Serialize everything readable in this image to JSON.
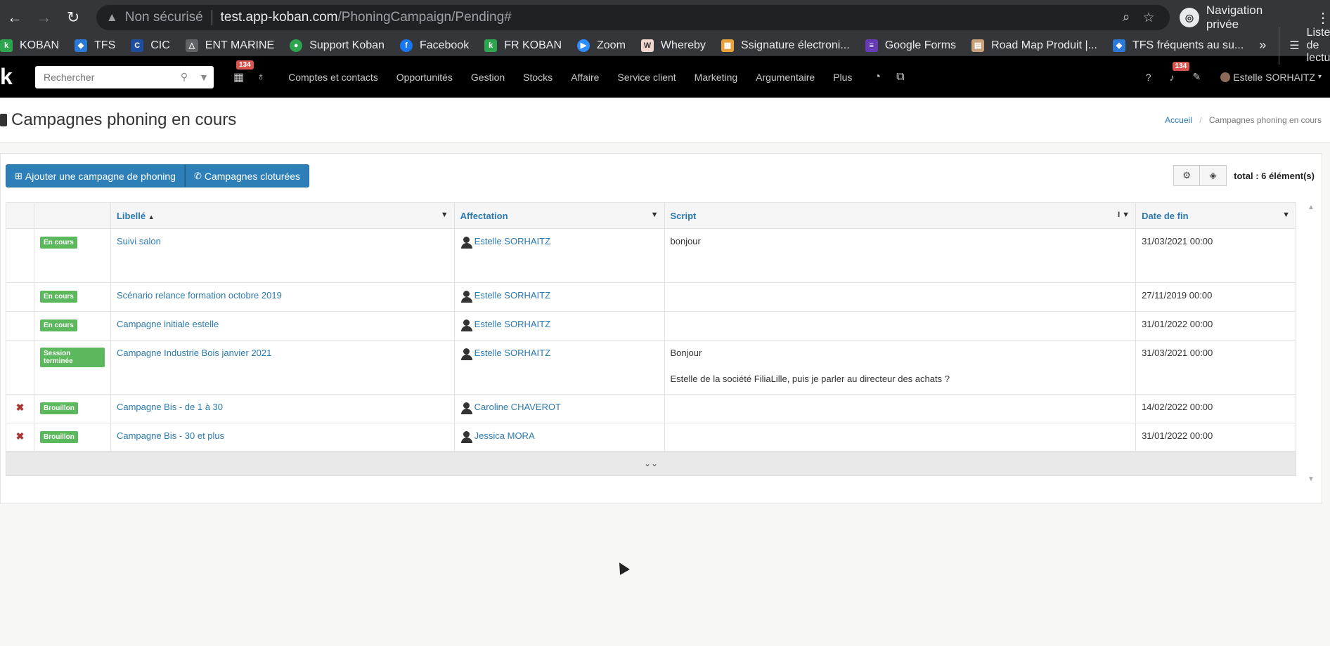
{
  "browser": {
    "insecure_label": "Non sécurisé",
    "url_host": "test.app-koban.com",
    "url_path": "/PhoningCampaign/Pending#",
    "profile_label": "Navigation privée",
    "bookmarks": [
      {
        "label": "KOBAN",
        "icon": "koban-icon",
        "color": "#2da44e"
      },
      {
        "label": "TFS",
        "icon": "tfs-icon",
        "color": "#2b79d6"
      },
      {
        "label": "CIC",
        "icon": "cic-icon",
        "color": "#1f4e9e"
      },
      {
        "label": "ENT MARINE",
        "icon": "ent-marine-icon",
        "color": "#5f6368"
      },
      {
        "label": "Support Koban",
        "icon": "support-icon",
        "color": "#2da44e"
      },
      {
        "label": "Facebook",
        "icon": "facebook-icon",
        "color": "#1877f2"
      },
      {
        "label": "FR KOBAN",
        "icon": "koban-icon",
        "color": "#2da44e"
      },
      {
        "label": "Zoom",
        "icon": "zoom-icon",
        "color": "#2d8cff"
      },
      {
        "label": "Whereby",
        "icon": "whereby-icon",
        "color": "#f0d7cf"
      },
      {
        "label": "Ssignature électroni...",
        "icon": "signature-icon",
        "color": "#e8a33c"
      },
      {
        "label": "Google Forms",
        "icon": "google-forms-icon",
        "color": "#673ab7"
      },
      {
        "label": "Road Map Produit |...",
        "icon": "roadmap-icon",
        "color": "#c8a27a"
      },
      {
        "label": "TFS fréquents au su...",
        "icon": "tfs-icon",
        "color": "#2b79d6"
      }
    ],
    "more_bookmarks": "»",
    "reading_list": "Liste de lecture"
  },
  "app": {
    "search_placeholder": "Rechercher",
    "calendar_badge": "134",
    "notif_badge": "134",
    "menu": [
      "Comptes et contacts",
      "Opportunités",
      "Gestion",
      "Stocks",
      "Affaire",
      "Service client",
      "Marketing",
      "Argumentaire",
      "Plus"
    ],
    "user_name": "Estelle SORHAITZ"
  },
  "page": {
    "title": "Campagnes phoning en cours",
    "breadcrumb": [
      "Accueil",
      "Campagnes phoning en cours"
    ],
    "add_button": "Ajouter une campagne de phoning",
    "closed_button": "Campagnes cloturées",
    "total": "total : 6 élément(s)"
  },
  "table": {
    "columns": [
      "Libellé",
      "Affectation",
      "Script",
      "Date de fin"
    ],
    "rows": [
      {
        "delete": "",
        "status": "En cours",
        "libelle": "Suivi salon",
        "affectation": "Estelle SORHAITZ",
        "script1": "bonjour",
        "script2": "",
        "date": "31/03/2021 00:00"
      },
      {
        "delete": "",
        "status": "En cours",
        "libelle": "Scénario relance formation octobre 2019",
        "affectation": "Estelle SORHAITZ",
        "script1": "",
        "script2": "",
        "date": "27/11/2019 00:00"
      },
      {
        "delete": "",
        "status": "En cours",
        "libelle": "Campagne initiale estelle",
        "affectation": "Estelle SORHAITZ",
        "script1": "",
        "script2": "",
        "date": "31/01/2022 00:00"
      },
      {
        "delete": "",
        "status": "Session terminée",
        "libelle": "Campagne Industrie Bois janvier 2021",
        "affectation": "Estelle SORHAITZ",
        "script1": "Bonjour",
        "script2": "Estelle de la société  FiliaLille, puis je parler au directeur des achats ?",
        "date": "31/03/2021 00:00"
      },
      {
        "delete": "✖",
        "status": "Brouillon",
        "libelle": "Campagne Bis - de 1 à 30",
        "affectation": "Caroline CHAVEROT",
        "script1": "",
        "script2": "",
        "date": "14/02/2022 00:00"
      },
      {
        "delete": "✖",
        "status": "Brouillon",
        "libelle": "Campagne Bis - 30 et plus",
        "affectation": "Jessica MORA",
        "script1": "",
        "script2": "",
        "date": "31/01/2022 00:00"
      }
    ]
  }
}
